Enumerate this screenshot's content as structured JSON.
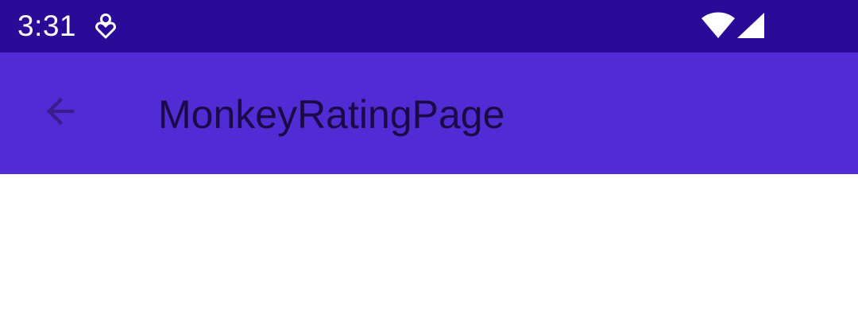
{
  "status_bar": {
    "time": "3:31",
    "background": "#2a0b98",
    "icons": [
      "app-notification-icon",
      "wifi-icon",
      "cell-signal-icon"
    ]
  },
  "app_bar": {
    "background": "#512bd4",
    "title": "MonkeyRatingPage",
    "title_color": "#1a0b47",
    "back_icon": "arrow-back-icon"
  },
  "content": {
    "background": "#ffffff"
  }
}
